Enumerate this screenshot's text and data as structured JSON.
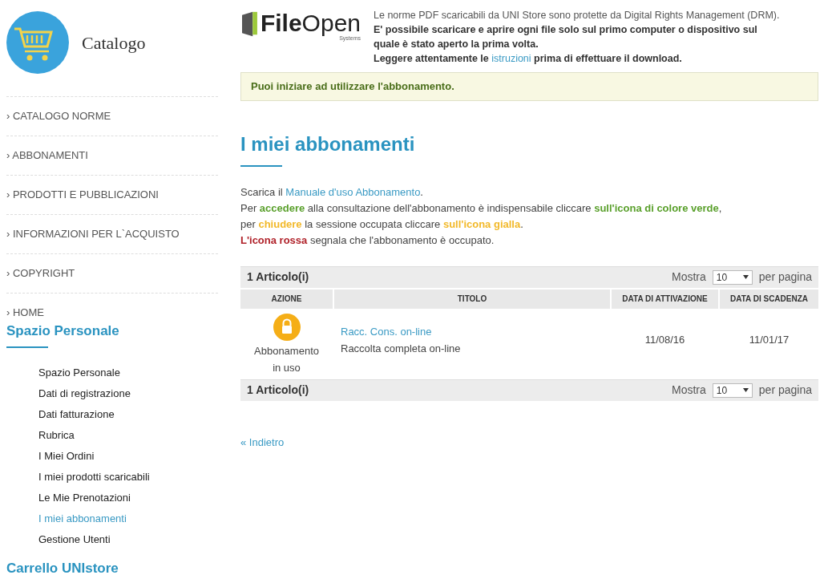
{
  "sidebar": {
    "logo_title": "Catalogo",
    "nav": [
      "› CATALOGO NORME",
      "› ABBONAMENTI",
      "› PRODOTTI E PUBBLICAZIONI",
      "› INFORMAZIONI PER L`ACQUISTO",
      "› COPYRIGHT",
      "› HOME"
    ],
    "personal_heading": "Spazio Personale",
    "personal_items": [
      {
        "label": "Spazio Personale",
        "selected": false
      },
      {
        "label": "Dati di registrazione",
        "selected": false
      },
      {
        "label": "Dati fatturazione",
        "selected": false
      },
      {
        "label": "Rubrica",
        "selected": false
      },
      {
        "label": "I Miei Ordini",
        "selected": false
      },
      {
        "label": "I miei prodotti scaricabili",
        "selected": false
      },
      {
        "label": "Le Mie Prenotazioni",
        "selected": false
      },
      {
        "label": "I miei abbonamenti",
        "selected": true
      },
      {
        "label": "Gestione Utenti",
        "selected": false
      }
    ],
    "cart_heading": "Carrello UNIstore"
  },
  "drm": {
    "logo_word_bold": "File",
    "logo_word": "Open",
    "logo_sub": "Systems",
    "lines": [
      [
        {
          "kind": "plain",
          "text": "Le norme PDF scaricabili da UNI Store sono protette da Digital Rights Management (DRM)."
        }
      ],
      [
        {
          "kind": "bold",
          "text": "E' possibile scaricare e aprire ogni file solo sul primo computer o dispositivo sul"
        }
      ],
      [
        {
          "kind": "bold",
          "text": "quale è stato aperto la prima volta."
        }
      ],
      [
        {
          "kind": "bold",
          "text": "Leggere attentamente le "
        },
        {
          "kind": "link",
          "text": "istruzioni"
        },
        {
          "kind": "bold",
          "text": " prima di effettuare il download."
        }
      ]
    ]
  },
  "notice": "Puoi iniziare ad utilizzare l'abbonamento.",
  "page_title": "I miei abbonamenti",
  "intro": [
    [
      {
        "kind": "plain",
        "text": "Scarica il "
      },
      {
        "kind": "link",
        "text": "Manuale d'uso Abbonamento"
      },
      {
        "kind": "plain",
        "text": "."
      }
    ],
    [
      {
        "kind": "plain",
        "text": "Per "
      },
      {
        "kind": "green",
        "text": "accedere"
      },
      {
        "kind": "plain",
        "text": " alla consultazione dell'abbonamento è indispensabile cliccare "
      },
      {
        "kind": "green",
        "text": "sull'icona di colore verde"
      },
      {
        "kind": "plain",
        "text": ","
      }
    ],
    [
      {
        "kind": "plain",
        "text": "per "
      },
      {
        "kind": "yellow",
        "text": "chiudere"
      },
      {
        "kind": "plain",
        "text": " la sessione occupata cliccare "
      },
      {
        "kind": "yellow",
        "text": "sull'icona gialla"
      },
      {
        "kind": "plain",
        "text": "."
      }
    ],
    [
      {
        "kind": "red",
        "text": "L'icona rossa"
      },
      {
        "kind": "plain",
        "text": " segnala che l'abbonamento è occupato."
      }
    ]
  ],
  "table": {
    "top_bar": {
      "count": "1 Articolo(i)",
      "show": "Mostra",
      "page_size": "10",
      "per_page": "per pagina"
    },
    "columns": [
      "AZIONE",
      "TITOLO",
      "DATA DI ATTIVAZIONE",
      "DATA DI SCADENZA"
    ],
    "rows": [
      {
        "color": "#f5ae17",
        "action_label": "Abbonamento in uso",
        "title": "Racc. Cons. on-line",
        "description": "Raccolta completa on-line",
        "activation": "11/08/16",
        "expiry": "11/01/17"
      }
    ],
    "bottom_bar": {
      "count": "1 Articolo(i)",
      "show": "Mostra",
      "page_size": "10",
      "per_page": "per pagina"
    }
  },
  "back_link": "« Indietro"
}
